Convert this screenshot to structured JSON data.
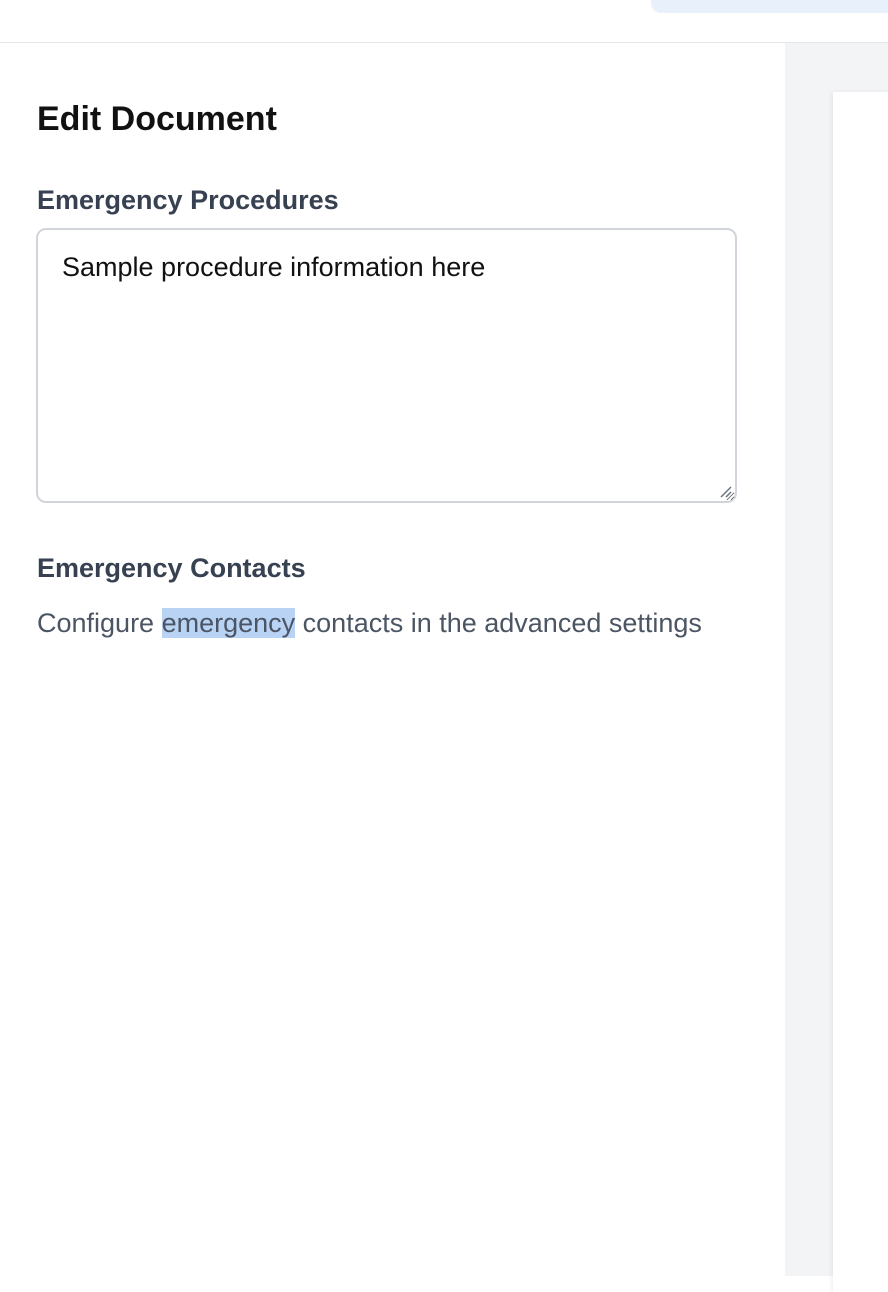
{
  "header": {
    "accent_color": "#e8f0fc"
  },
  "editor": {
    "title": "Edit Document",
    "procedures": {
      "label": "Emergency Procedures",
      "value": "Sample procedure information here"
    },
    "contacts": {
      "label": "Emergency Contacts",
      "help_before": "Configure ",
      "help_selected": "emergency",
      "help_after": " contacts in the advanced settings"
    }
  },
  "colors": {
    "selection": "#b9d3f5",
    "preview_background": "#f3f4f6"
  }
}
